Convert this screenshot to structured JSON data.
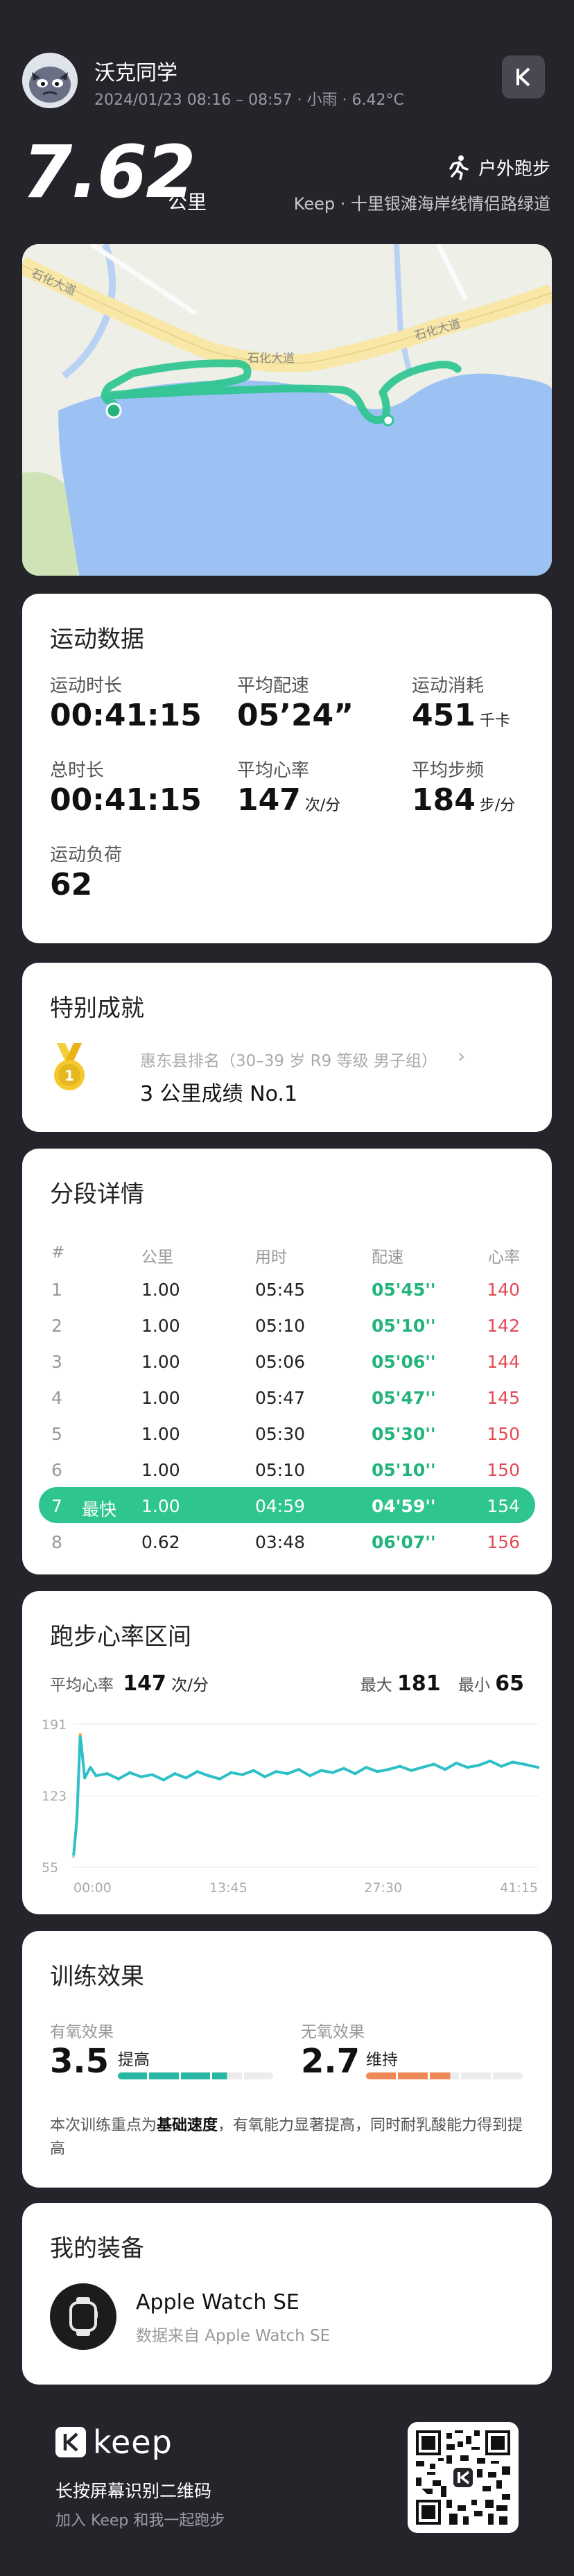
{
  "header": {
    "username": "沃克同学",
    "meta": "2024/01/23 08:16 – 08:57 · 小雨 · 6.42°C",
    "distance": "7.62",
    "distance_unit": "公里",
    "sport_type": "户外跑步",
    "route": "Keep · 十里银滩海岸线情侣路绿道"
  },
  "map": {
    "road_labels": [
      "石化大道",
      "石化大道",
      "石化大道"
    ],
    "route_color": "#2ec58f",
    "water_color": "#9cc1f3",
    "land_color": "#eef0e8",
    "road_color": "#f8e7a6"
  },
  "stats": {
    "title": "运动数据",
    "items": [
      {
        "label": "运动时长",
        "value": "00:41:15",
        "unit": ""
      },
      {
        "label": "平均配速",
        "value": "05’24”",
        "unit": ""
      },
      {
        "label": "运动消耗",
        "value": "451",
        "unit": "千卡"
      },
      {
        "label": "总时长",
        "value": "00:41:15",
        "unit": ""
      },
      {
        "label": "平均心率",
        "value": "147",
        "unit": "次/分"
      },
      {
        "label": "平均步频",
        "value": "184",
        "unit": "步/分"
      },
      {
        "label": "运动负荷",
        "value": "62",
        "unit": ""
      }
    ]
  },
  "achievement": {
    "title": "特别成就",
    "rank": "惠东县排名（30–39 岁 R9 等级 男子组）",
    "result": "3 公里成绩 No.1",
    "medal_color": "#e6b820"
  },
  "segments": {
    "title": "分段详情",
    "headers": [
      "#",
      "公里",
      "用时",
      "配速",
      "心率"
    ],
    "fastest_tag": "最快",
    "rows": [
      {
        "idx": "1",
        "km": "1.00",
        "time": "05:45",
        "pace": "05'45''",
        "hr": "140"
      },
      {
        "idx": "2",
        "km": "1.00",
        "time": "05:10",
        "pace": "05'10''",
        "hr": "142"
      },
      {
        "idx": "3",
        "km": "1.00",
        "time": "05:06",
        "pace": "05'06''",
        "hr": "144"
      },
      {
        "idx": "4",
        "km": "1.00",
        "time": "05:47",
        "pace": "05'47''",
        "hr": "145"
      },
      {
        "idx": "5",
        "km": "1.00",
        "time": "05:30",
        "pace": "05'30''",
        "hr": "150"
      },
      {
        "idx": "6",
        "km": "1.00",
        "time": "05:10",
        "pace": "05'10''",
        "hr": "150"
      },
      {
        "idx": "7",
        "km": "1.00",
        "time": "04:59",
        "pace": "04'59''",
        "hr": "154"
      },
      {
        "idx": "8",
        "km": "0.62",
        "time": "03:48",
        "pace": "06'07''",
        "hr": "156"
      }
    ]
  },
  "heart_rate": {
    "title": "跑步心率区间",
    "avg_label": "平均心率",
    "avg_value": "147",
    "avg_unit": "次/分",
    "max_label": "最大",
    "max_value": "181",
    "min_label": "最小",
    "min_value": "65",
    "line_color": "#2ec0c6"
  },
  "chart_data": {
    "type": "line",
    "title": "",
    "xlabel": "",
    "ylabel": "",
    "x_ticks": [
      "00:00",
      "13:45",
      "27:30",
      "41:15"
    ],
    "y_ticks": [
      "191",
      "123",
      "55"
    ],
    "ylim": [
      55,
      191
    ],
    "xlim": [
      0,
      41.25
    ],
    "series": [
      {
        "x": [
          0,
          0.3,
          0.6,
          1.0,
          1.5,
          2,
          3,
          4,
          5,
          6,
          7,
          8,
          9,
          10,
          11,
          12,
          13,
          14,
          15,
          16,
          17,
          18,
          19,
          20,
          21,
          22,
          23,
          24,
          25,
          26,
          27,
          28,
          29,
          30,
          31,
          32,
          33,
          34,
          35,
          36,
          37,
          38,
          39,
          40,
          41.25
        ],
        "values": [
          65,
          100,
          181,
          140,
          150,
          142,
          144,
          139,
          145,
          141,
          143,
          138,
          144,
          140,
          146,
          142,
          139,
          145,
          143,
          147,
          141,
          146,
          144,
          148,
          142,
          147,
          145,
          149,
          144,
          150,
          146,
          148,
          151,
          147,
          150,
          153,
          148,
          154,
          150,
          152,
          156,
          151,
          155,
          153,
          150
        ]
      }
    ]
  },
  "training": {
    "title": "训练效果",
    "aerobic_label": "有氧效果",
    "aerobic_value": "3.5",
    "aerobic_level": "提高",
    "aerobic_fill": 0.7,
    "aerobic_color": "#27b7a3",
    "anaerobic_label": "无氧效果",
    "anaerobic_value": "2.7",
    "anaerobic_level": "维持",
    "anaerobic_fill": 0.54,
    "anaerobic_color": "#ef8a58",
    "desc_prefix": "本次训练重点为",
    "desc_emph": "基础速度",
    "desc_suffix": "，有氧能力显著提高，同时耐乳酸能力得到提高"
  },
  "equipment": {
    "title": "我的装备",
    "device": "Apple Watch SE",
    "source": "数据来自 Apple Watch SE"
  },
  "footer": {
    "brand": "keep",
    "qr_hint": "长按屏幕识别二维码",
    "invite": "加入 Keep 和我一起跑步"
  }
}
